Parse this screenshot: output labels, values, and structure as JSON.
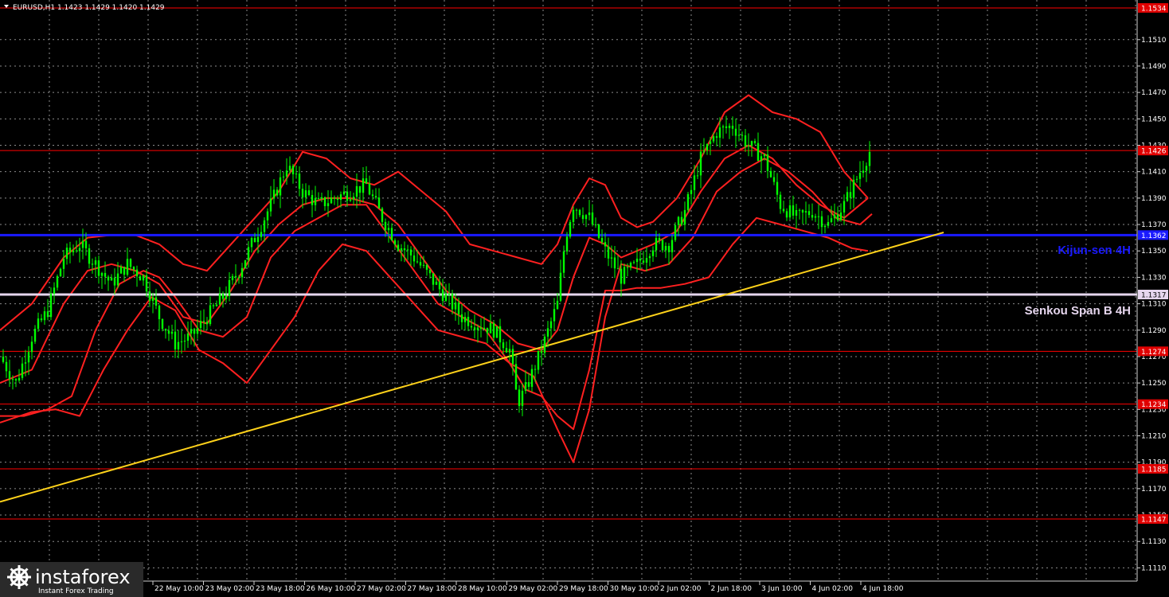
{
  "header": {
    "symbol_text": "EURUSD,H1  1.1423 1.1429 1.1420 1.1429"
  },
  "watermark": {
    "brand": "instaforex",
    "tagline": "Instant Forex Trading"
  },
  "colors": {
    "background": "#000000",
    "grid": "#8c8c8c",
    "candles": "#00ff00",
    "ichimoku": "#ff2020",
    "levels": "#ff0000",
    "kijun": "#1a1aff",
    "senkou": "#e6d6ee",
    "trendline": "#ffd21a",
    "label_bg": "#e00000"
  },
  "chart_data": {
    "type": "line",
    "title": "EURUSD,H1",
    "ylim": [
      1.11,
      1.154
    ],
    "ytick_labels": [
      "1.1110",
      "1.1130",
      "1.1150",
      "1.1170",
      "1.1190",
      "1.1210",
      "1.1230",
      "1.1250",
      "1.1270",
      "1.1290",
      "1.1310",
      "1.1330",
      "1.1350",
      "1.1370",
      "1.1390",
      "1.1410",
      "1.1430",
      "1.1450",
      "1.1470",
      "1.1490",
      "1.1510"
    ],
    "xtick_labels": [
      "22 May 10:00",
      "23 May 02:00",
      "23 May 18:00",
      "26 May 10:00",
      "27 May 02:00",
      "27 May 18:00",
      "28 May 10:00",
      "29 May 02:00",
      "29 May 18:00",
      "30 May 10:00",
      "2 Jun 02:00",
      "2 Jun 18:00",
      "3 Jun 10:00",
      "4 Jun 02:00",
      "4 Jun 18:00"
    ],
    "horizontal_levels": [
      {
        "label": "1.1534",
        "value": 1.1534,
        "kind": "level"
      },
      {
        "label": "1.1426",
        "value": 1.1426,
        "kind": "level"
      },
      {
        "label": "1.1362",
        "value": 1.1362,
        "kind": "kijun"
      },
      {
        "label": "1.1317",
        "value": 1.1317,
        "kind": "senkou"
      },
      {
        "label": "1.1274",
        "value": 1.1274,
        "kind": "level"
      },
      {
        "label": "1.1234",
        "value": 1.1234,
        "kind": "level"
      },
      {
        "label": "1.1185",
        "value": 1.1185,
        "kind": "level"
      },
      {
        "label": "1.1147",
        "value": 1.1147,
        "kind": "level"
      }
    ],
    "line_labels": {
      "kijun": "Kijun-sen 4H",
      "senkou": "Senkou Span B 4H"
    },
    "trendline": {
      "x": [
        0,
        1185
      ],
      "y": [
        1.116,
        1.1364
      ]
    },
    "price_path": {
      "x": [
        0,
        20,
        40,
        60,
        80,
        100,
        120,
        140,
        160,
        180,
        200,
        220,
        240,
        260,
        280,
        300,
        320,
        340,
        360,
        380,
        400,
        420,
        440,
        460,
        480,
        500,
        520,
        540,
        560,
        580,
        600,
        620,
        640,
        650,
        660,
        680,
        700,
        710,
        720,
        740,
        760,
        780,
        800,
        820,
        840,
        860,
        880,
        900,
        920,
        940,
        960,
        980,
        1000,
        1020,
        1040,
        1060,
        1080,
        1095
      ],
      "y": [
        1.127,
        1.125,
        1.1285,
        1.1305,
        1.1345,
        1.1355,
        1.134,
        1.1325,
        1.134,
        1.133,
        1.13,
        1.128,
        1.1285,
        1.13,
        1.1315,
        1.1335,
        1.136,
        1.1385,
        1.1415,
        1.1395,
        1.1385,
        1.139,
        1.1395,
        1.14,
        1.1375,
        1.1355,
        1.1345,
        1.133,
        1.1315,
        1.13,
        1.1295,
        1.129,
        1.1275,
        1.1235,
        1.1245,
        1.1275,
        1.131,
        1.136,
        1.1385,
        1.1375,
        1.135,
        1.133,
        1.134,
        1.1355,
        1.1355,
        1.138,
        1.142,
        1.144,
        1.1445,
        1.143,
        1.142,
        1.1385,
        1.1375,
        1.138,
        1.137,
        1.1385,
        1.141,
        1.1429
      ]
    },
    "ichimoku_lines": [
      {
        "x": [
          0,
          40,
          80,
          110,
          140,
          170,
          200,
          230,
          260,
          290,
          320,
          350,
          380,
          410,
          440,
          470,
          500,
          530,
          560,
          590,
          620,
          650,
          680,
          700,
          720,
          740,
          760,
          780,
          800,
          820,
          850,
          880,
          910,
          940,
          970,
          1000,
          1030,
          1060,
          1090
        ],
        "y": [
          1.125,
          1.126,
          1.131,
          1.1335,
          1.134,
          1.1335,
          1.1325,
          1.13,
          1.1295,
          1.132,
          1.135,
          1.137,
          1.1385,
          1.139,
          1.139,
          1.1385,
          1.137,
          1.1345,
          1.132,
          1.1305,
          1.1295,
          1.128,
          1.1275,
          1.129,
          1.133,
          1.136,
          1.1355,
          1.1345,
          1.135,
          1.1355,
          1.1365,
          1.1395,
          1.142,
          1.143,
          1.142,
          1.14,
          1.1385,
          1.1375,
          1.139
        ]
      },
      {
        "x": [
          0,
          30,
          60,
          90,
          120,
          150,
          180,
          200,
          220,
          250,
          280,
          310,
          340,
          370,
          400,
          430,
          460,
          490,
          520,
          550,
          580,
          610,
          640,
          670,
          700,
          720,
          740,
          760,
          780,
          810,
          840,
          870,
          900,
          930,
          960,
          990,
          1020,
          1050,
          1080,
          1095
        ],
        "y": [
          1.1225,
          1.1225,
          1.123,
          1.124,
          1.129,
          1.1325,
          1.1335,
          1.133,
          1.1315,
          1.129,
          1.1285,
          1.13,
          1.1345,
          1.1365,
          1.1375,
          1.1385,
          1.1385,
          1.136,
          1.1335,
          1.131,
          1.13,
          1.129,
          1.1265,
          1.1255,
          1.1215,
          1.119,
          1.123,
          1.13,
          1.134,
          1.1335,
          1.134,
          1.136,
          1.1395,
          1.141,
          1.142,
          1.141,
          1.1395,
          1.1375,
          1.137,
          1.1378
        ]
      },
      {
        "x": [
          0,
          40,
          80,
          110,
          140,
          170,
          200,
          230,
          260,
          290,
          320,
          350,
          380,
          410,
          440,
          470,
          500,
          530,
          560,
          590,
          620,
          650,
          680,
          700,
          720,
          740,
          760,
          780,
          800,
          820,
          850,
          880,
          910,
          940,
          970,
          1000,
          1030,
          1060,
          1090
        ],
        "y": [
          1.129,
          1.131,
          1.1345,
          1.136,
          1.1362,
          1.1362,
          1.1355,
          1.134,
          1.1335,
          1.1355,
          1.1375,
          1.1395,
          1.1425,
          1.142,
          1.1405,
          1.14,
          1.141,
          1.1395,
          1.138,
          1.1355,
          1.135,
          1.1345,
          1.134,
          1.1355,
          1.1385,
          1.1405,
          1.14,
          1.1375,
          1.1368,
          1.1372,
          1.139,
          1.142,
          1.1455,
          1.1468,
          1.1455,
          1.145,
          1.144,
          1.141,
          1.139
        ]
      },
      {
        "x": [
          0,
          40,
          70,
          100,
          130,
          160,
          190,
          220,
          250,
          280,
          310,
          340,
          370,
          400,
          430,
          460,
          490,
          520,
          550,
          580,
          610,
          640,
          660,
          680,
          700,
          720,
          740,
          760,
          780,
          800,
          830,
          860,
          890,
          920,
          950,
          980,
          1010,
          1040,
          1070,
          1090
        ],
        "y": [
          1.122,
          1.1228,
          1.123,
          1.1225,
          1.126,
          1.129,
          1.1315,
          1.1305,
          1.1275,
          1.1265,
          1.125,
          1.1275,
          1.13,
          1.1335,
          1.1355,
          1.135,
          1.133,
          1.131,
          1.129,
          1.1285,
          1.128,
          1.1265,
          1.1245,
          1.124,
          1.1225,
          1.1215,
          1.126,
          1.132,
          1.132,
          1.1322,
          1.1322,
          1.1325,
          1.133,
          1.1355,
          1.1375,
          1.137,
          1.1365,
          1.136,
          1.1352,
          1.135
        ]
      }
    ]
  }
}
